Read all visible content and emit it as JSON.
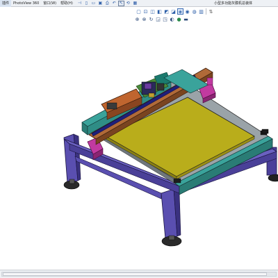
{
  "app": {
    "document_title": "小型多功能灰膜机总装体"
  },
  "menubar": {
    "items": [
      "插件",
      "PhotoView 360",
      "窗口(W)",
      "帮助(H)"
    ]
  },
  "viewbar": {
    "buttons": [
      "zoom-to-fit-icon",
      "zoom-to-area-icon",
      "previous-view-icon",
      "section-view-icon",
      "view-orientation-icon",
      "display-style-icon",
      "hide-show-items-icon",
      "edit-appearance-icon",
      "apply-scene-icon",
      "view-settings-icon",
      "shadows-icon",
      "perspective-icon"
    ]
  },
  "hud": {
    "buttons": [
      "zoom-fit-icon",
      "zoom-area-icon",
      "rotate-icon",
      "section-icon",
      "orientation-icon",
      "display-icon",
      "appearance-icon",
      "scene-icon"
    ]
  },
  "colors": {
    "frame": "#5a4fb0",
    "plate": "#b9ad1b",
    "rail": "#2f8d86",
    "carriage": "#a9572a",
    "bracket": "#c13aa0",
    "foot": "#2a2a2a"
  }
}
